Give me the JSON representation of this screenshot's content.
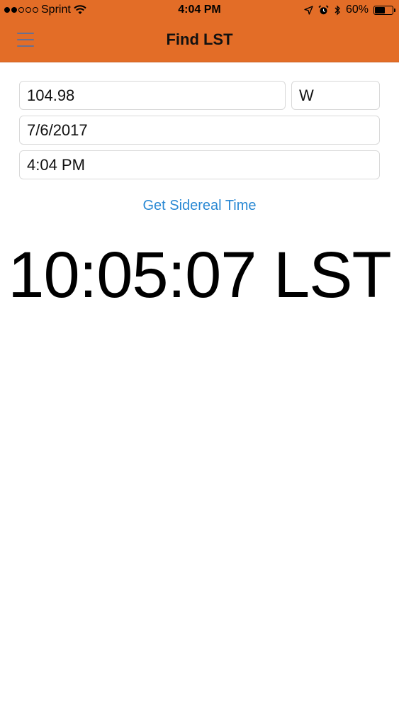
{
  "status_bar": {
    "carrier": "Sprint",
    "time": "4:04 PM",
    "battery": "60%",
    "battery_level": 0.6,
    "icons": [
      "signal-dots",
      "wifi-icon",
      "location-arrow-icon",
      "alarm-icon",
      "bluetooth-icon",
      "battery-icon"
    ]
  },
  "nav": {
    "title": "Find LST",
    "menu_icon": "hamburger-menu-icon"
  },
  "form": {
    "longitude": "104.98",
    "direction": "W",
    "date": "7/6/2017",
    "time": "4:04 PM"
  },
  "action": {
    "label": "Get Sidereal Time"
  },
  "result": {
    "text": "10:05:07 LST"
  },
  "colors": {
    "header": "#e36d27",
    "link": "#2a89d4",
    "menu_icon": "#6a6f8f"
  }
}
